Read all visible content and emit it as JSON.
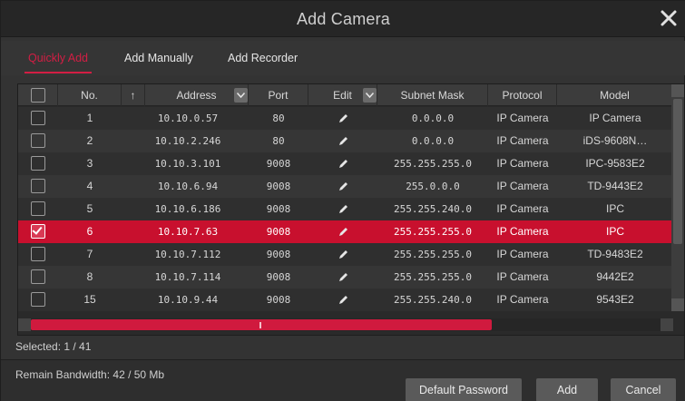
{
  "window": {
    "title": "Add Camera",
    "close_icon": "close-icon"
  },
  "tabs": [
    {
      "label": "Quickly Add",
      "active": true
    },
    {
      "label": "Add Manually",
      "active": false
    },
    {
      "label": "Add Recorder",
      "active": false
    }
  ],
  "table": {
    "columns": [
      "",
      "No.",
      "↑",
      "Address",
      "Port",
      "Edit",
      "Subnet Mask",
      "Protocol",
      "Model"
    ],
    "rows": [
      {
        "no": "1",
        "address": "10.10.0.57",
        "port": "80",
        "subnet": "0.0.0.0",
        "protocol": "IP Camera",
        "model": "IP Camera",
        "checked": false
      },
      {
        "no": "2",
        "address": "10.10.2.246",
        "port": "80",
        "subnet": "0.0.0.0",
        "protocol": "IP Camera",
        "model": "iDS-9608N…",
        "checked": false
      },
      {
        "no": "3",
        "address": "10.10.3.101",
        "port": "9008",
        "subnet": "255.255.255.0",
        "protocol": "IP Camera",
        "model": "IPC-9583E2",
        "checked": false
      },
      {
        "no": "4",
        "address": "10.10.6.94",
        "port": "9008",
        "subnet": "255.0.0.0",
        "protocol": "IP Camera",
        "model": "TD-9443E2",
        "checked": false
      },
      {
        "no": "5",
        "address": "10.10.6.186",
        "port": "9008",
        "subnet": "255.255.240.0",
        "protocol": "IP Camera",
        "model": "IPC",
        "checked": false
      },
      {
        "no": "6",
        "address": "10.10.7.63",
        "port": "9008",
        "subnet": "255.255.255.0",
        "protocol": "IP Camera",
        "model": "IPC",
        "checked": true
      },
      {
        "no": "7",
        "address": "10.10.7.112",
        "port": "9008",
        "subnet": "255.255.255.0",
        "protocol": "IP Camera",
        "model": "TD-9483E2",
        "checked": false
      },
      {
        "no": "8",
        "address": "10.10.7.114",
        "port": "9008",
        "subnet": "255.255.255.0",
        "protocol": "IP Camera",
        "model": "9442E2",
        "checked": false
      },
      {
        "no": "15",
        "address": "10.10.9.44",
        "port": "9008",
        "subnet": "255.255.240.0",
        "protocol": "IP Camera",
        "model": "9543E2",
        "checked": false
      }
    ]
  },
  "status": {
    "selected": "Selected: 1 / 41"
  },
  "footer": {
    "bandwidth": "Remain Bandwidth: 42 / 50 Mb",
    "buttons": {
      "default_password": "Default Password",
      "add": "Add",
      "cancel": "Cancel"
    }
  },
  "colors": {
    "accent": "#c8102e",
    "background": "#333333",
    "header": "#3c3c3c"
  }
}
